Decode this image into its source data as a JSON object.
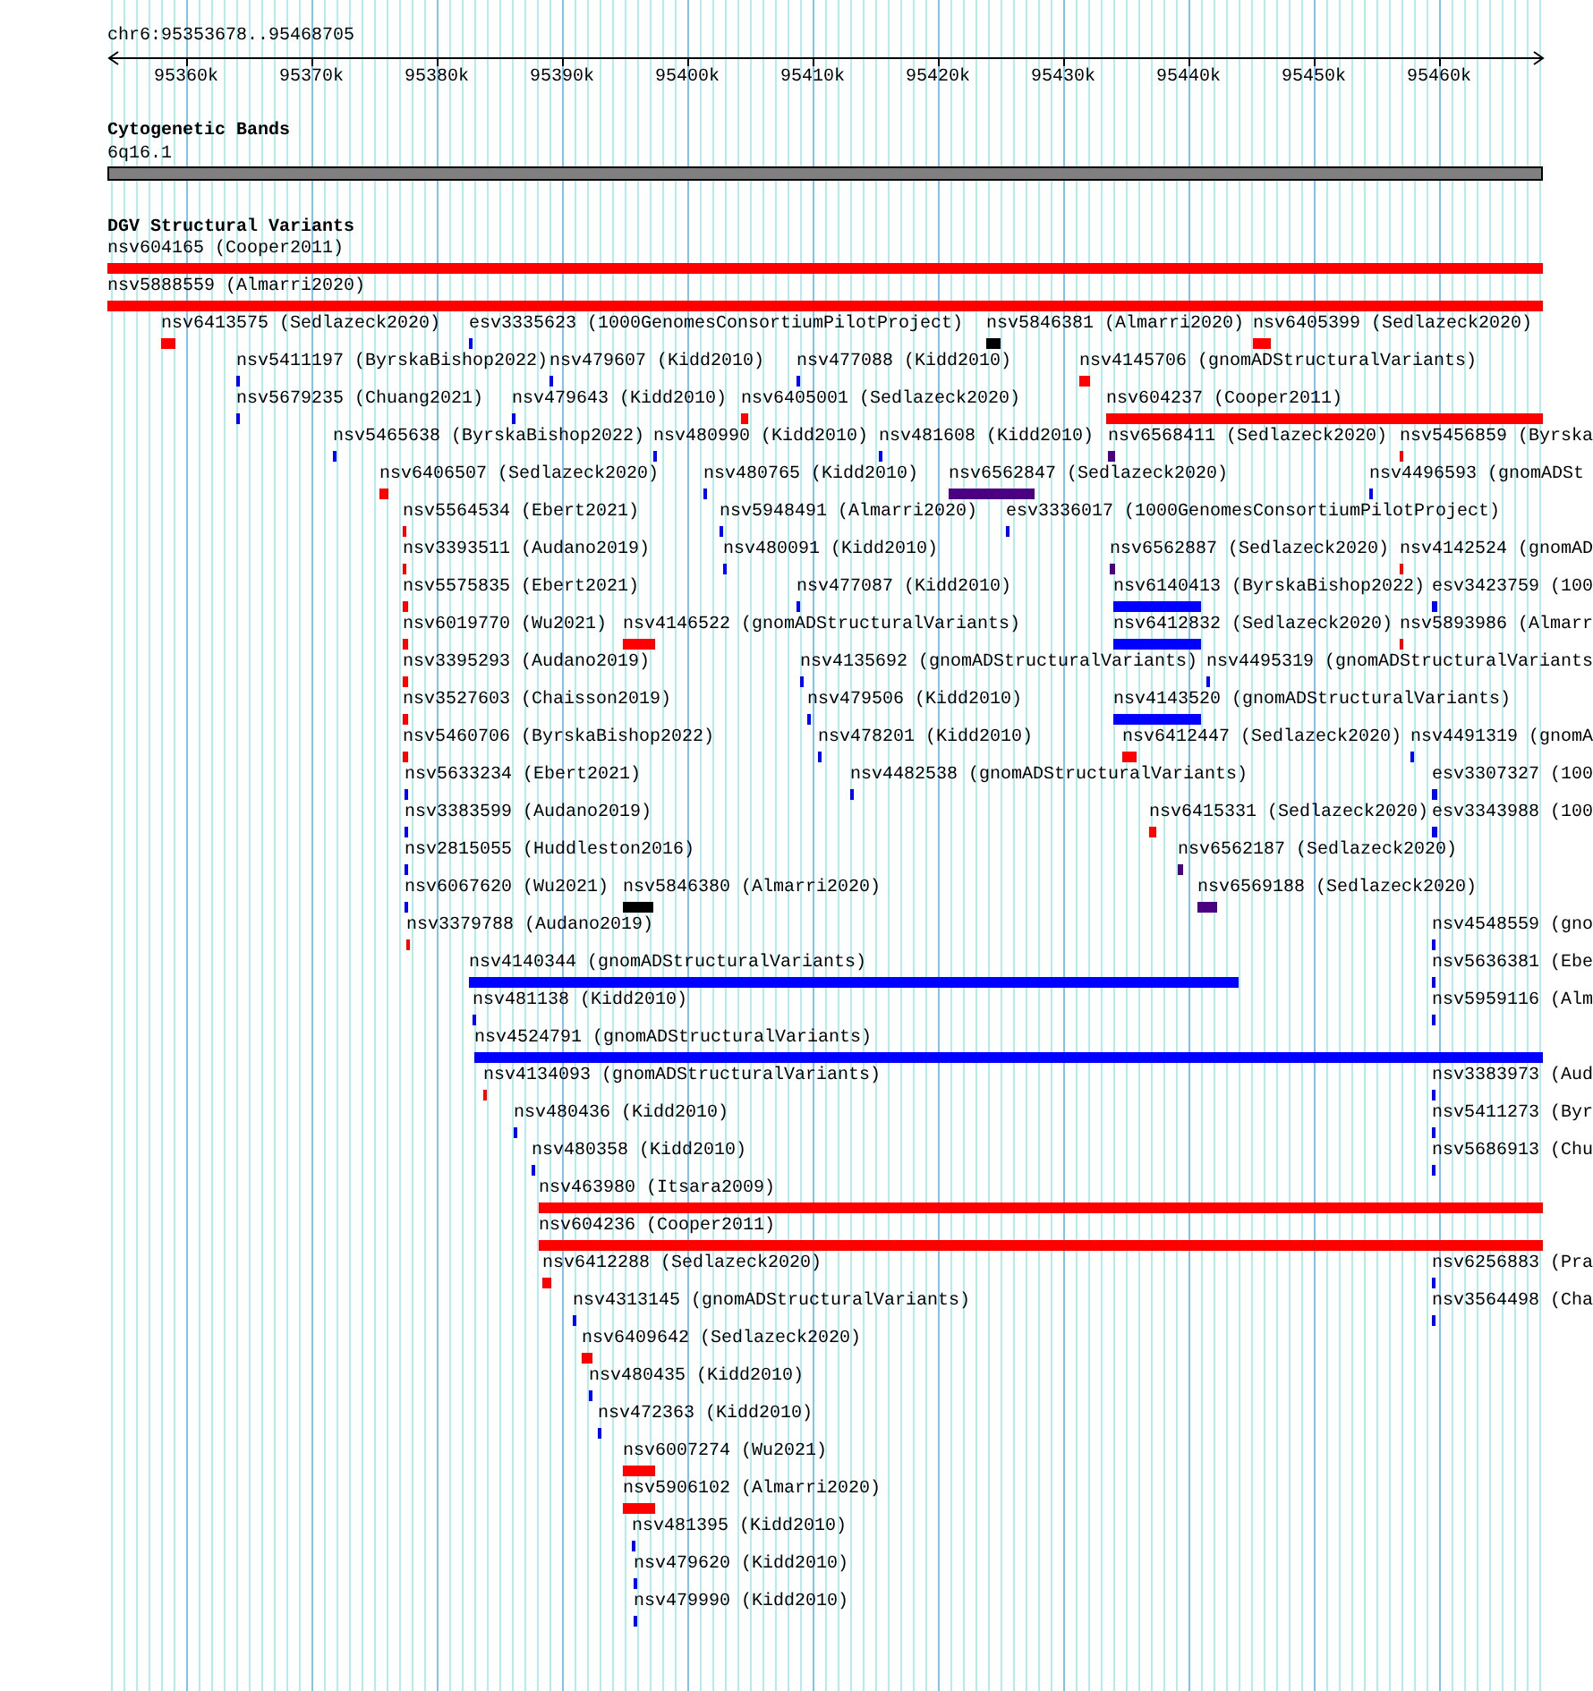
{
  "ruler": {
    "region": "chr6:95353678..95468705",
    "ticks": [
      "95360k",
      "95370k",
      "95380k",
      "95390k",
      "95400k",
      "95410k",
      "95420k",
      "95430k",
      "95440k",
      "95450k",
      "95460k"
    ]
  },
  "tracks": [
    {
      "title": "Cytogenetic Bands",
      "features": [
        {
          "label": "6q16.1",
          "color": "#808080"
        }
      ]
    },
    {
      "title": "DGV Structural Variants",
      "features": [
        {
          "label": "nsv604165 (Cooper2011)",
          "color": "#ff0000"
        },
        {
          "label": "nsv5888559 (Almarri2020)",
          "color": "#ff0000"
        },
        {
          "label": "nsv6413575 (Sedlazeck2020)",
          "color": "#ff0000"
        },
        {
          "label": "esv3335623 (1000GenomesConsortiumPilotProject)",
          "color": "#0000ff"
        },
        {
          "label": "nsv5846381 (Almarri2020)",
          "color": "#000000"
        },
        {
          "label": "nsv6405399 (Sedlazeck2020)",
          "color": "#ff0000"
        },
        {
          "label": "nsv5411197 (ByrskaBishop2022)",
          "color": "#0000ff"
        },
        {
          "label": "nsv479607 (Kidd2010)",
          "color": "#0000ff"
        },
        {
          "label": "nsv477088 (Kidd2010)",
          "color": "#0000ff"
        },
        {
          "label": "nsv4145706 (gnomADStructuralVariants)",
          "color": "#ff0000"
        },
        {
          "label": "nsv5679235 (Chuang2021)",
          "color": "#0000ff"
        },
        {
          "label": "nsv479643 (Kidd2010)",
          "color": "#0000ff"
        },
        {
          "label": "nsv6405001 (Sedlazeck2020)",
          "color": "#ff0000"
        },
        {
          "label": "nsv604237 (Cooper2011)",
          "color": "#ff0000"
        },
        {
          "label": "nsv5465638 (ByrskaBishop2022)",
          "color": "#0000ff"
        },
        {
          "label": "nsv480990 (Kidd2010)",
          "color": "#0000ff"
        },
        {
          "label": "nsv481608 (Kidd2010)",
          "color": "#0000ff"
        },
        {
          "label": "nsv6568411 (Sedlazeck2020)",
          "color": "#4b0082"
        },
        {
          "label": "nsv5456859 (Byrska",
          "color": "#ff0000"
        },
        {
          "label": "nsv6406507 (Sedlazeck2020)",
          "color": "#ff0000"
        },
        {
          "label": "nsv480765 (Kidd2010)",
          "color": "#0000ff"
        },
        {
          "label": "nsv6562847 (Sedlazeck2020)",
          "color": "#4b0082"
        },
        {
          "label": "nsv4496593 (gnomADSt",
          "color": "#0000ff"
        },
        {
          "label": "nsv5564534 (Ebert2021)",
          "color": "#ff0000"
        },
        {
          "label": "nsv5948491 (Almarri2020)",
          "color": "#0000ff"
        },
        {
          "label": "esv3336017 (1000GenomesConsortiumPilotProject)",
          "color": "#0000ff"
        },
        {
          "label": "nsv3393511 (Audano2019)",
          "color": "#ff0000"
        },
        {
          "label": "nsv480091 (Kidd2010)",
          "color": "#0000ff"
        },
        {
          "label": "nsv6562887 (Sedlazeck2020)",
          "color": "#4b0082"
        },
        {
          "label": "nsv4142524 (gnomAD",
          "color": "#ff0000"
        },
        {
          "label": "nsv5575835 (Ebert2021)",
          "color": "#ff0000"
        },
        {
          "label": "nsv477087 (Kidd2010)",
          "color": "#0000ff"
        },
        {
          "label": "nsv6140413 (ByrskaBishop2022)",
          "color": "#0000ff"
        },
        {
          "label": "esv3423759 (100",
          "color": "#0000ff"
        },
        {
          "label": "nsv6019770 (Wu2021)",
          "color": "#ff0000"
        },
        {
          "label": "nsv4146522 (gnomADStructuralVariants)",
          "color": "#ff0000"
        },
        {
          "label": "nsv6412832 (Sedlazeck2020)",
          "color": "#0000ff"
        },
        {
          "label": "nsv5893986 (Almarr",
          "color": "#ff0000"
        },
        {
          "label": "nsv3395293 (Audano2019)",
          "color": "#ff0000"
        },
        {
          "label": "nsv4135692 (gnomADStructuralVariants)",
          "color": "#0000ff"
        },
        {
          "label": "nsv4495319 (gnomADStructuralVariants",
          "color": "#0000ff"
        },
        {
          "label": "nsv3527603 (Chaisson2019)",
          "color": "#ff0000"
        },
        {
          "label": "nsv479506 (Kidd2010)",
          "color": "#0000ff"
        },
        {
          "label": "nsv4143520 (gnomADStructuralVariants)",
          "color": "#0000ff"
        },
        {
          "label": "nsv5460706 (ByrskaBishop2022)",
          "color": "#ff0000"
        },
        {
          "label": "nsv478201 (Kidd2010)",
          "color": "#0000ff"
        },
        {
          "label": "nsv6412447 (Sedlazeck2020)",
          "color": "#ff0000"
        },
        {
          "label": "nsv4491319 (gnomA",
          "color": "#0000ff"
        },
        {
          "label": "nsv5633234 (Ebert2021)",
          "color": "#0000ff"
        },
        {
          "label": "nsv4482538 (gnomADStructuralVariants)",
          "color": "#0000ff"
        },
        {
          "label": "esv3307327 (100",
          "color": "#0000ff"
        },
        {
          "label": "nsv3383599 (Audano2019)",
          "color": "#0000ff"
        },
        {
          "label": "nsv6415331 (Sedlazeck2020)",
          "color": "#ff0000"
        },
        {
          "label": "esv3343988 (100",
          "color": "#0000ff"
        },
        {
          "label": "nsv2815055 (Huddleston2016)",
          "color": "#0000ff"
        },
        {
          "label": "nsv6562187 (Sedlazeck2020)",
          "color": "#4b0082"
        },
        {
          "label": "nsv6067620 (Wu2021)",
          "color": "#0000ff"
        },
        {
          "label": "nsv5846380 (Almarri2020)",
          "color": "#000000"
        },
        {
          "label": "nsv6569188 (Sedlazeck2020)",
          "color": "#4b0082"
        },
        {
          "label": "nsv3379788 (Audano2019)",
          "color": "#ff0000"
        },
        {
          "label": "nsv4548559 (gno",
          "color": "#0000ff"
        },
        {
          "label": "nsv4140344 (gnomADStructuralVariants)",
          "color": "#0000ff"
        },
        {
          "label": "nsv5636381 (Ebe",
          "color": "#0000ff"
        },
        {
          "label": "nsv481138 (Kidd2010)",
          "color": "#0000ff"
        },
        {
          "label": "nsv5959116 (Alm",
          "color": "#0000ff"
        },
        {
          "label": "nsv4524791 (gnomADStructuralVariants)",
          "color": "#0000ff"
        },
        {
          "label": "nsv4134093 (gnomADStructuralVariants)",
          "color": "#ff0000"
        },
        {
          "label": "nsv3383973 (Aud",
          "color": "#0000ff"
        },
        {
          "label": "nsv480436 (Kidd2010)",
          "color": "#0000ff"
        },
        {
          "label": "nsv5411273 (Byr",
          "color": "#0000ff"
        },
        {
          "label": "nsv480358 (Kidd2010)",
          "color": "#0000ff"
        },
        {
          "label": "nsv5686913 (Chu",
          "color": "#0000ff"
        },
        {
          "label": "nsv463980 (Itsara2009)",
          "color": "#ff0000"
        },
        {
          "label": "nsv604236 (Cooper2011)",
          "color": "#ff0000"
        },
        {
          "label": "nsv6412288 (Sedlazeck2020)",
          "color": "#ff0000"
        },
        {
          "label": "nsv6256883 (Pra",
          "color": "#0000ff"
        },
        {
          "label": "nsv4313145 (gnomADStructuralVariants)",
          "color": "#0000ff"
        },
        {
          "label": "nsv3564498 (Cha",
          "color": "#0000ff"
        },
        {
          "label": "nsv6409642 (Sedlazeck2020)",
          "color": "#ff0000"
        },
        {
          "label": "nsv480435 (Kidd2010)",
          "color": "#0000ff"
        },
        {
          "label": "nsv472363 (Kidd2010)",
          "color": "#0000ff"
        },
        {
          "label": "nsv6007274 (Wu2021)",
          "color": "#ff0000"
        },
        {
          "label": "nsv5906102 (Almarri2020)",
          "color": "#ff0000"
        },
        {
          "label": "nsv481395 (Kidd2010)",
          "color": "#0000ff"
        },
        {
          "label": "nsv479620 (Kidd2010)",
          "color": "#0000ff"
        },
        {
          "label": "nsv479990 (Kidd2010)",
          "color": "#0000ff"
        }
      ]
    }
  ]
}
